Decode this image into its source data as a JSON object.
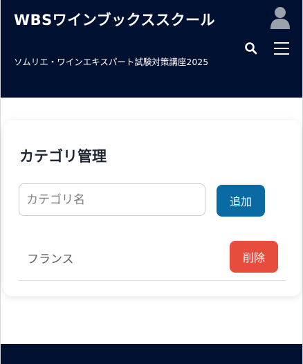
{
  "header": {
    "site_title": "WBSワインブックススクール",
    "site_subtitle": "ソムリエ・ワインエキスパート試験対策講座2025",
    "icons": [
      "user-icon",
      "search-icon",
      "menu-icon"
    ],
    "background_color": "#001030"
  },
  "card": {
    "title": "カテゴリ管理",
    "input": {
      "placeholder": "カテゴリ名",
      "value": ""
    },
    "add_label": "追加",
    "categories": [
      {
        "name": "フランス",
        "delete_label": "削除"
      }
    ]
  },
  "colors": {
    "add_button": "#0a6aa3",
    "delete_button": "#e74c3c",
    "navy": "#001030"
  }
}
